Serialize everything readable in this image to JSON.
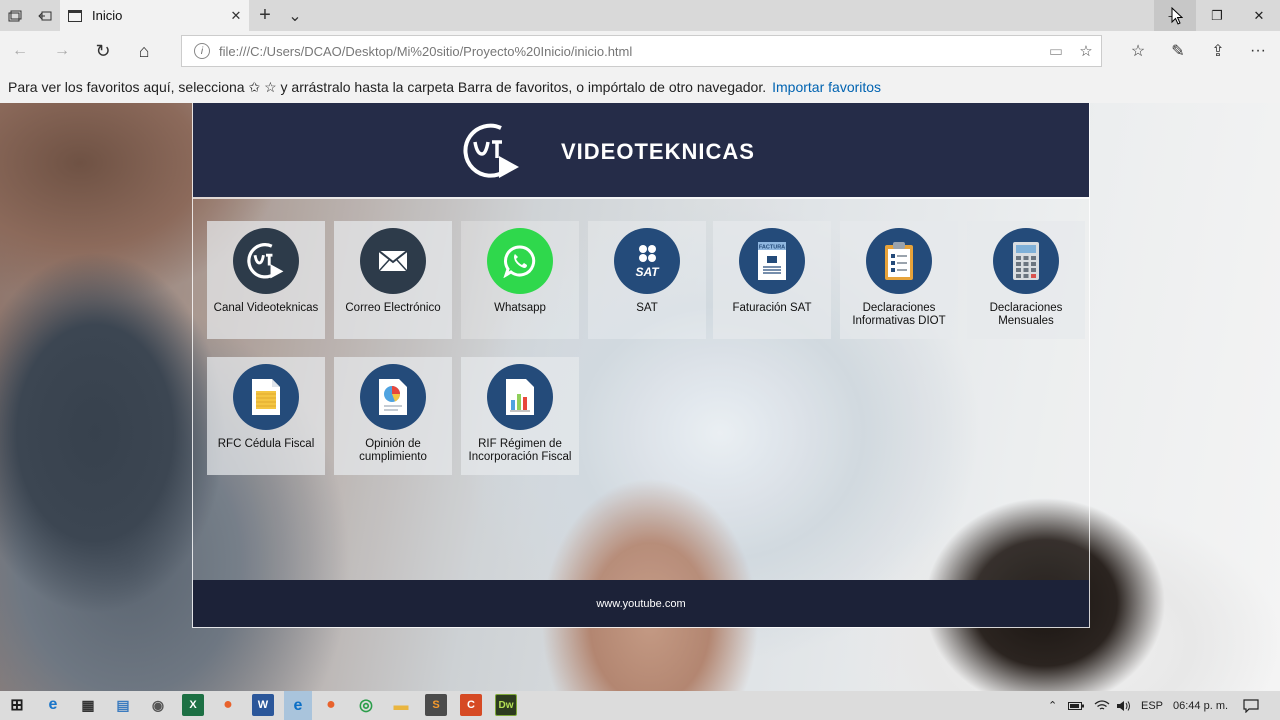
{
  "browser": {
    "tab_title": "Inicio",
    "tab_close": "✕",
    "new_tab": "+",
    "tab_list": "⌄",
    "window": {
      "minimize": "—",
      "restore": "❐",
      "close": "✕"
    },
    "nav": {
      "back": "←",
      "forward": "→",
      "refresh": "↻",
      "home": "⌂"
    },
    "address": "file:///C:/Users/DCAO/Desktop/Mi%20sitio/Proyecto%20Inicio/inicio.html",
    "address_icons": {
      "info": "i",
      "reading_view": "▭",
      "favorite": "☆"
    },
    "toolbar_icons": {
      "hub": "☆",
      "notes": "✎",
      "share": "⇪",
      "more": "···"
    },
    "favorites_bar": {
      "text": "Para ver los favoritos aquí, selecciona  ✩  ☆ y arrástralo hasta la carpeta Barra de favoritos, o impórtalo de otro navegador.",
      "link": "Importar favoritos"
    }
  },
  "site": {
    "brand": "VIDEOTEKNICAS",
    "footer": "www.youtube.com",
    "tiles": [
      {
        "label": "Canal Videoteknicas",
        "icon": "vt-play-logo-icon"
      },
      {
        "label": "Correo Electrónico",
        "icon": "envelope-icon"
      },
      {
        "label": "Whatsapp",
        "icon": "whatsapp-icon"
      },
      {
        "label": "SAT",
        "icon": "sat-logo-icon",
        "icon_text": "SAT"
      },
      {
        "label": "Faturación SAT",
        "icon": "invoice-icon",
        "icon_text": "FACTURA"
      },
      {
        "label": "Declaraciones Informativas DIOT",
        "icon": "clipboard-icon"
      },
      {
        "label": "Declaraciones Mensuales",
        "icon": "calculator-icon"
      },
      {
        "label": "RFC Cédula Fiscal",
        "icon": "document-icon"
      },
      {
        "label": "Opinión de cumplimiento",
        "icon": "pie-report-icon"
      },
      {
        "label": "RIF Régimen de Incorporación Fiscal",
        "icon": "bar-report-icon"
      }
    ]
  },
  "taskbar": {
    "language": "ESP",
    "clock": "06:44 p. m.",
    "apps": [
      {
        "name": "start",
        "label": "⊞"
      },
      {
        "name": "internet-explorer",
        "label": "e"
      },
      {
        "name": "calculator",
        "label": "▦"
      },
      {
        "name": "notepad",
        "label": "▤"
      },
      {
        "name": "paint",
        "label": "◉"
      },
      {
        "name": "excel",
        "label": "X"
      },
      {
        "name": "firefox",
        "label": "●"
      },
      {
        "name": "word",
        "label": "W"
      },
      {
        "name": "edge",
        "label": "e"
      },
      {
        "name": "firefox-2",
        "label": "●"
      },
      {
        "name": "chrome",
        "label": "◎"
      },
      {
        "name": "file-explorer",
        "label": "▬"
      },
      {
        "name": "sublime",
        "label": "S"
      },
      {
        "name": "camtasia",
        "label": "C"
      },
      {
        "name": "dreamweaver",
        "label": "Dw"
      }
    ]
  },
  "colors": {
    "header_bg": "#252c48",
    "footer_bg": "#1c2238",
    "circle_blue": "#244b7a",
    "whatsapp_green": "#2fd84c",
    "link_blue": "#0063b1"
  }
}
